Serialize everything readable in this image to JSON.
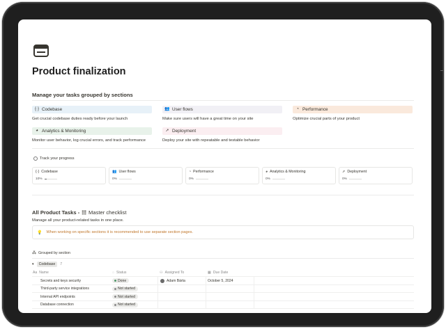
{
  "page": {
    "icon": "browser-window-icon",
    "title": "Product finalization"
  },
  "sections_heading": "Manage your tasks grouped by sections",
  "sections": [
    {
      "icon": "code-icon",
      "icon_glyph": "{·}",
      "label": "Codebase",
      "color": "#e7f1f8",
      "description": "Get crucial codebase duties ready before your launch"
    },
    {
      "icon": "users-icon",
      "icon_glyph": "👥",
      "label": "User flows",
      "color": "#f1f0f5",
      "description": "Make sure users will have a great time on your site"
    },
    {
      "icon": "gauge-icon",
      "icon_glyph": "◔",
      "label": "Performance",
      "color": "#fae9dc",
      "description": "Optimize crucial parts of your product"
    },
    {
      "icon": "chart-icon",
      "icon_glyph": "◕",
      "label": "Analytics & Monitoring",
      "color": "#e8f2ea",
      "description": "Monitor user behavior, log crucial errors, and track performance"
    },
    {
      "icon": "paper-plane-icon",
      "icon_glyph": "➚",
      "label": "Deployment",
      "color": "#fbeef1",
      "description": "Deploy your site with repeatable and testable behavior"
    }
  ],
  "progress": {
    "heading": "Track your progress",
    "items": [
      {
        "icon": "code-icon",
        "icon_glyph": "{·}",
        "label": "Codebase",
        "value_text": "10%",
        "value": 0.1
      },
      {
        "icon": "users-icon",
        "icon_glyph": "👥",
        "label": "User flows",
        "value_text": "0%",
        "value": 0
      },
      {
        "icon": "gauge-icon",
        "icon_glyph": "◔",
        "label": "Performance",
        "value_text": "0%",
        "value": 0
      },
      {
        "icon": "chart-icon",
        "icon_glyph": "◕",
        "label": "Analytics & Monitoring",
        "value_text": "0%",
        "value": 0
      },
      {
        "icon": "paper-plane-icon",
        "icon_glyph": "➚",
        "label": "Deployment",
        "value_text": "0%",
        "value": 0
      }
    ]
  },
  "tasks": {
    "title": "All Product Tasks -",
    "checklist_icon": "checklist-icon",
    "checklist_label": "Master checklist",
    "description": "Manage all your product-related tasks in one place.",
    "callout": "When working on specific sections it is recommended to use separate section pages.",
    "grouped_by": "Grouped by section",
    "group": {
      "label": "Codebase",
      "count": "7"
    },
    "columns": {
      "name": "Name",
      "status": "Status",
      "assigned": "Assigned To",
      "due": "Due Date"
    },
    "rows": [
      {
        "name": "Secrets and keys security",
        "status": "Done",
        "status_color": "#4f9768",
        "assignee": "Adam Bárta",
        "due": "October 5, 2024"
      },
      {
        "name": "Third-party service integrations",
        "status": "Not started",
        "status_color": "#8a8a8a",
        "assignee": "",
        "due": ""
      },
      {
        "name": "Internal API endpoints",
        "status": "Not started",
        "status_color": "#8a8a8a",
        "assignee": "",
        "due": ""
      },
      {
        "name": "Database connection",
        "status": "Not started",
        "status_color": "#8a8a8a",
        "assignee": "",
        "due": ""
      }
    ]
  }
}
